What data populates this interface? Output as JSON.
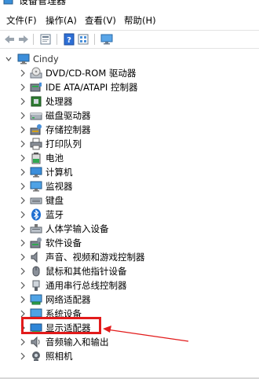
{
  "window": {
    "title": "设备管理器"
  },
  "menu": [
    {
      "label": "文件(F)"
    },
    {
      "label": "操作(A)"
    },
    {
      "label": "查看(V)"
    },
    {
      "label": "帮助(H)"
    }
  ],
  "toolbar": [
    "back-arrow-icon",
    "forward-arrow-icon",
    "properties-icon",
    "help-icon",
    "view-icon",
    "monitor-scan-icon"
  ],
  "tree": {
    "root": {
      "label": "Cindy",
      "icon": "computer-icon"
    },
    "items": [
      {
        "label": "DVD/CD-ROM 驱动器",
        "icon": "dvd-drive-icon"
      },
      {
        "label": "IDE ATA/ATAPI 控制器",
        "icon": "ide-controller-icon"
      },
      {
        "label": "处理器",
        "icon": "processor-icon"
      },
      {
        "label": "磁盘驱动器",
        "icon": "disk-drive-icon"
      },
      {
        "label": "存储控制器",
        "icon": "storage-controller-icon"
      },
      {
        "label": "打印队列",
        "icon": "printer-icon"
      },
      {
        "label": "电池",
        "icon": "battery-icon"
      },
      {
        "label": "计算机",
        "icon": "computer-icon"
      },
      {
        "label": "监视器",
        "icon": "monitor-icon"
      },
      {
        "label": "键盘",
        "icon": "keyboard-icon"
      },
      {
        "label": "蓝牙",
        "icon": "bluetooth-icon"
      },
      {
        "label": "人体学输入设备",
        "icon": "hid-icon"
      },
      {
        "label": "软件设备",
        "icon": "software-device-icon"
      },
      {
        "label": "声音、视频和游戏控制器",
        "icon": "speaker-icon"
      },
      {
        "label": "鼠标和其他指针设备",
        "icon": "mouse-icon"
      },
      {
        "label": "通用串行总线控制器",
        "icon": "usb-icon"
      },
      {
        "label": "网络适配器",
        "icon": "network-adapter-icon"
      },
      {
        "label": "系统设备",
        "icon": "system-device-icon"
      },
      {
        "label": "显示适配器",
        "icon": "display-adapter-icon"
      },
      {
        "label": "音频输入和输出",
        "icon": "audio-io-icon"
      },
      {
        "label": "照相机",
        "icon": "camera-icon"
      }
    ]
  },
  "annotation": {
    "highlighted_item": "显示适配器",
    "color": "#e21b1b"
  }
}
